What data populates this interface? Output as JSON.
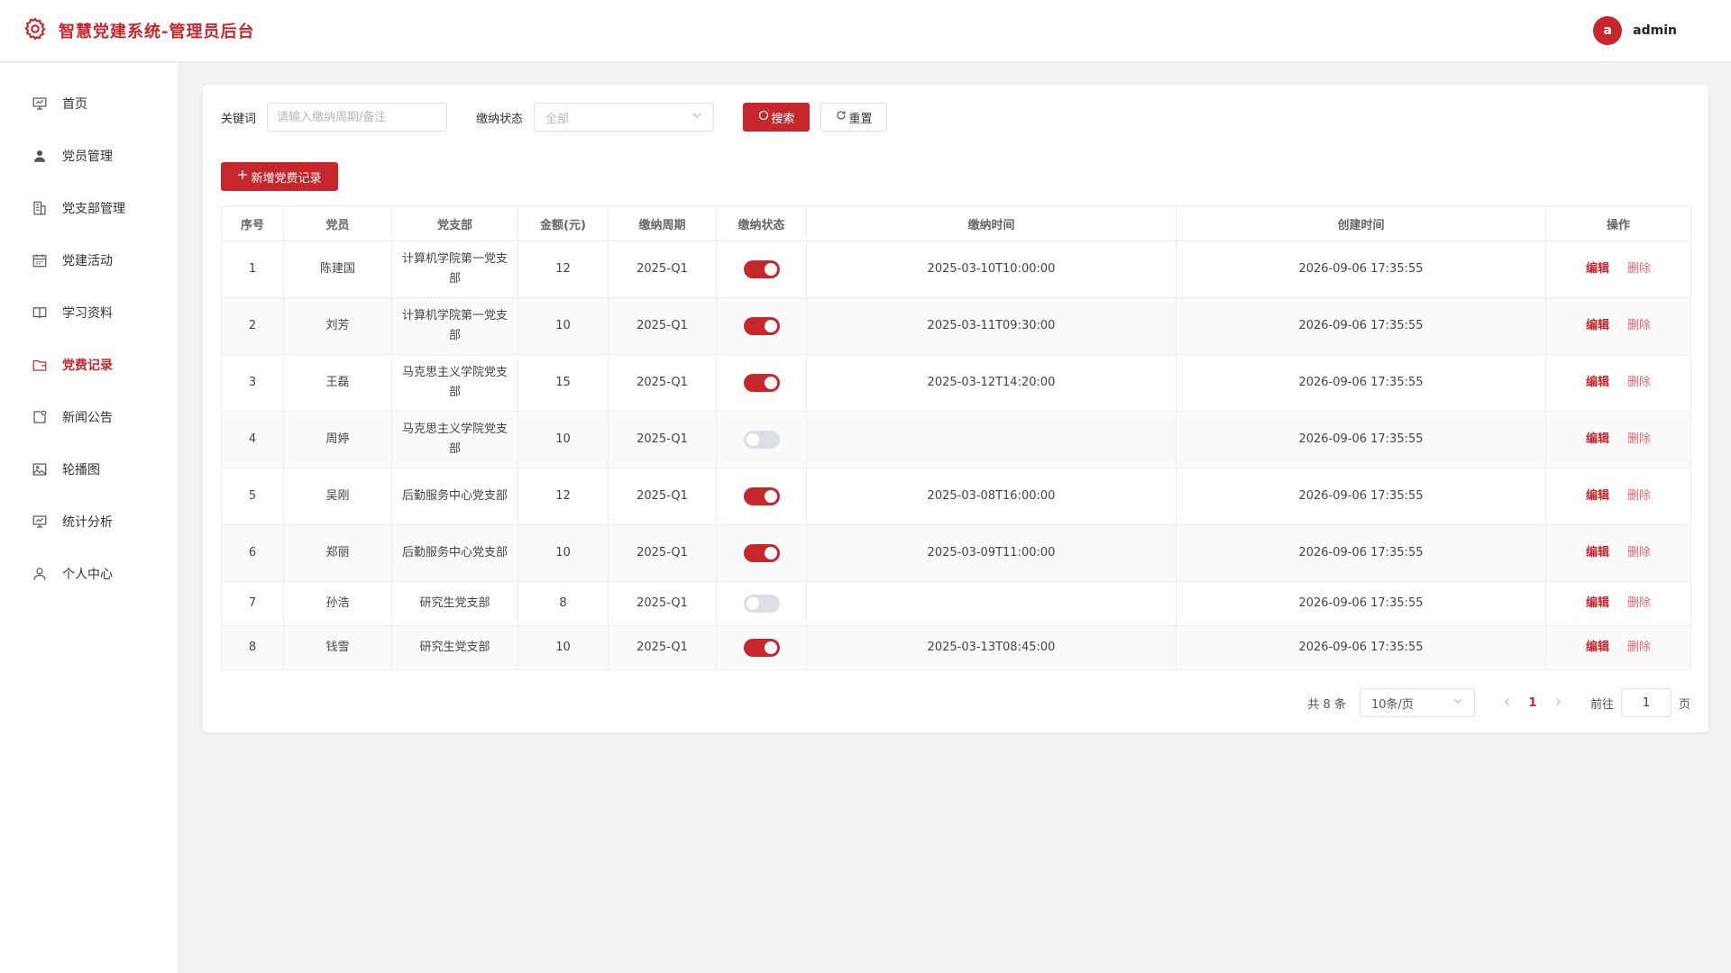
{
  "header": {
    "title": "智慧党建系统-管理员后台",
    "avatar_letter": "a",
    "username": "admin"
  },
  "sidebar": {
    "items": [
      {
        "label": "首页",
        "icon": "presentation-icon",
        "active": false
      },
      {
        "label": "党员管理",
        "icon": "user-icon",
        "active": false
      },
      {
        "label": "党支部管理",
        "icon": "building-icon",
        "active": false
      },
      {
        "label": "党建活动",
        "icon": "calendar-icon",
        "active": false
      },
      {
        "label": "学习资料",
        "icon": "book-icon",
        "active": false
      },
      {
        "label": "党费记录",
        "icon": "wallet-icon",
        "active": true
      },
      {
        "label": "新闻公告",
        "icon": "news-icon",
        "active": false
      },
      {
        "label": "轮播图",
        "icon": "image-icon",
        "active": false
      },
      {
        "label": "统计分析",
        "icon": "chart-icon",
        "active": false
      },
      {
        "label": "个人中心",
        "icon": "person-icon",
        "active": false
      }
    ]
  },
  "filters": {
    "keyword_label": "关键词",
    "keyword_placeholder": "请输入缴纳周期/备注",
    "keyword_value": "",
    "status_label": "缴纳状态",
    "status_value": "全部",
    "search_label": "搜索",
    "reset_label": "重置"
  },
  "actions": {
    "add_label": "新增党费记录"
  },
  "table": {
    "columns": [
      "序号",
      "党员",
      "党支部",
      "金额(元)",
      "缴纳周期",
      "缴纳状态",
      "缴纳时间",
      "创建时间",
      "操作"
    ],
    "edit_label": "编辑",
    "delete_label": "删除",
    "rows": [
      {
        "index": "1",
        "member": "陈建国",
        "branch": "计算机学院第一党支部",
        "amount": "12",
        "period": "2025-Q1",
        "paid": true,
        "paid_time": "2025-03-10T10:00:00",
        "created": "2026-09-06 17:35:55"
      },
      {
        "index": "2",
        "member": "刘芳",
        "branch": "计算机学院第一党支部",
        "amount": "10",
        "period": "2025-Q1",
        "paid": true,
        "paid_time": "2025-03-11T09:30:00",
        "created": "2026-09-06 17:35:55"
      },
      {
        "index": "3",
        "member": "王磊",
        "branch": "马克思主义学院党支部",
        "amount": "15",
        "period": "2025-Q1",
        "paid": true,
        "paid_time": "2025-03-12T14:20:00",
        "created": "2026-09-06 17:35:55"
      },
      {
        "index": "4",
        "member": "周婷",
        "branch": "马克思主义学院党支部",
        "amount": "10",
        "period": "2025-Q1",
        "paid": false,
        "paid_time": "",
        "created": "2026-09-06 17:35:55"
      },
      {
        "index": "5",
        "member": "吴刚",
        "branch": "后勤服务中心党支部",
        "amount": "12",
        "period": "2025-Q1",
        "paid": true,
        "paid_time": "2025-03-08T16:00:00",
        "created": "2026-09-06 17:35:55"
      },
      {
        "index": "6",
        "member": "郑丽",
        "branch": "后勤服务中心党支部",
        "amount": "10",
        "period": "2025-Q1",
        "paid": true,
        "paid_time": "2025-03-09T11:00:00",
        "created": "2026-09-06 17:35:55"
      },
      {
        "index": "7",
        "member": "孙浩",
        "branch": "研究生党支部",
        "amount": "8",
        "period": "2025-Q1",
        "paid": false,
        "paid_time": "",
        "created": "2026-09-06 17:35:55"
      },
      {
        "index": "8",
        "member": "钱雪",
        "branch": "研究生党支部",
        "amount": "10",
        "period": "2025-Q1",
        "paid": true,
        "paid_time": "2025-03-13T08:45:00",
        "created": "2026-09-06 17:35:55"
      }
    ]
  },
  "pagination": {
    "total_text": "共 8 条",
    "page_size": "10条/页",
    "current_page": "1",
    "goto_label": "前往",
    "goto_value": "1",
    "page_unit": "页"
  },
  "colors": {
    "accent": "#c8262d"
  }
}
